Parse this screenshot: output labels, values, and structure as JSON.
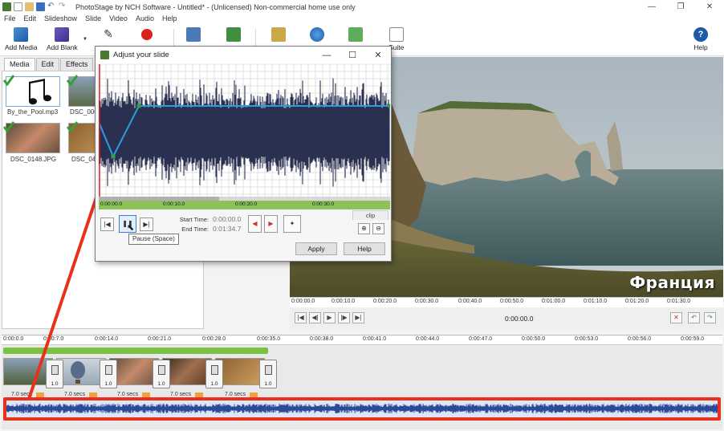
{
  "titlebar": {
    "title": "PhotoStage by NCH Software - Untitled* - (Unlicensed) Non-commercial home use only"
  },
  "menu": [
    "File",
    "Edit",
    "Slideshow",
    "Slide",
    "Video",
    "Audio",
    "Help"
  ],
  "toolbar": {
    "add_media": "Add Media",
    "add_blank": "Add Blank",
    "suite": "Suite",
    "help": "Help"
  },
  "tabs": [
    "Media",
    "Edit",
    "Effects"
  ],
  "media": [
    {
      "label": "By_the_Pool.mp3"
    },
    {
      "label": "DSC_0067"
    },
    {
      "label": "DSC_0148.JPG"
    },
    {
      "label": "DSC_047"
    }
  ],
  "preview": {
    "overlay_text": "Франция",
    "time": "0:00:00.0",
    "ruler": [
      "0:00:00.0",
      "0:00:10.0",
      "0:00:20.0",
      "0:00:30.0",
      "0:00:40.0",
      "0:00:50.0",
      "0:01:00.0",
      "0:01:10.0",
      "0:01:20.0",
      "0:01:30.0"
    ]
  },
  "timeline": {
    "ruler": [
      "0:00:0.0",
      "0:00:7.0",
      "0:00:14.0",
      "0:00:21.0",
      "0:00:28.0",
      "0:00:35.0",
      "0:00:38.0",
      "0:00:41.0",
      "0:00:44.0",
      "0:00:47.0",
      "0:00:50.0",
      "0:00:53.0",
      "0:00:56.0",
      "0:00:59.0"
    ],
    "transition_value": "1.0",
    "clip_duration": "7.0 secs"
  },
  "dialog": {
    "title": "Adjust your slide",
    "ruler": [
      "0:00:00.0",
      "0:00:10.0",
      "0:00:20.0",
      "0:00:30.0"
    ],
    "start_time_label": "Start Time:",
    "start_time_value": "0:00:00.0",
    "end_time_label": "End Time:",
    "end_time_value": "0:01:34.7",
    "clip_tab": "clip",
    "apply": "Apply",
    "help": "Help",
    "tooltip": "Pause (Space)"
  },
  "colors": {
    "waveform": "#2b3150",
    "volume_line": "#2d9be0",
    "highlight_box": "#e8311c",
    "green_bar": "#7ac144"
  }
}
